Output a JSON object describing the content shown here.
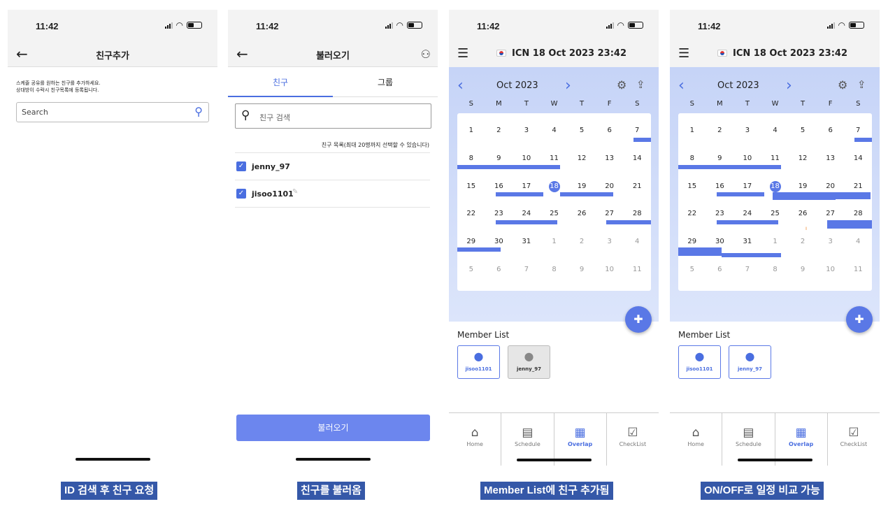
{
  "status_time": "11:42",
  "screen1": {
    "title": "친구추가",
    "desc_line1": "스케줄 공유를 원하는 친구를 추가하세요.",
    "desc_line2": "상대방이 수락시 친구목록에 등록됩니다.",
    "search_placeholder": "Search",
    "caption": "ID 검색 후 친구 요청"
  },
  "screen2": {
    "title": "불러오기",
    "tabs": [
      "친구",
      "그룹"
    ],
    "search_placeholder": "친구 검색",
    "list_label": "친구 목록(최대 20명까지 선택할 수 있습니다)",
    "friends": [
      "jenny_97",
      "jisoo1101"
    ],
    "load_button": "불러오기",
    "caption": "친구를 불러옴"
  },
  "calendar": {
    "header": "ICN   18 Oct 2023   23:42",
    "month": "Oct 2023",
    "dows": [
      "S",
      "M",
      "T",
      "W",
      "T",
      "F",
      "S"
    ],
    "weeks": [
      [
        "1",
        "2",
        "3",
        "4",
        "5",
        "6",
        "7"
      ],
      [
        "8",
        "9",
        "10",
        "11",
        "12",
        "13",
        "14"
      ],
      [
        "15",
        "16",
        "17",
        "18",
        "19",
        "20",
        "21"
      ],
      [
        "22",
        "23",
        "24",
        "25",
        "26",
        "27",
        "28"
      ],
      [
        "29",
        "30",
        "31",
        "1",
        "2",
        "3",
        "4"
      ],
      [
        "5",
        "6",
        "7",
        "8",
        "9",
        "10",
        "11"
      ]
    ],
    "member_list_title": "Member List",
    "nav": [
      "Home",
      "Schedule",
      "Overlap",
      "CheckList"
    ]
  },
  "screen3": {
    "members": [
      {
        "name": "jisoo1101",
        "on": true
      },
      {
        "name": "jenny_97",
        "on": false
      }
    ],
    "caption": "Member List에 친구 추가됨"
  },
  "screen4": {
    "members": [
      {
        "name": "jisoo1101",
        "on": true
      },
      {
        "name": "jenny_97",
        "on": true
      }
    ],
    "caption": "ON/OFF로 일정 비교 가능"
  }
}
